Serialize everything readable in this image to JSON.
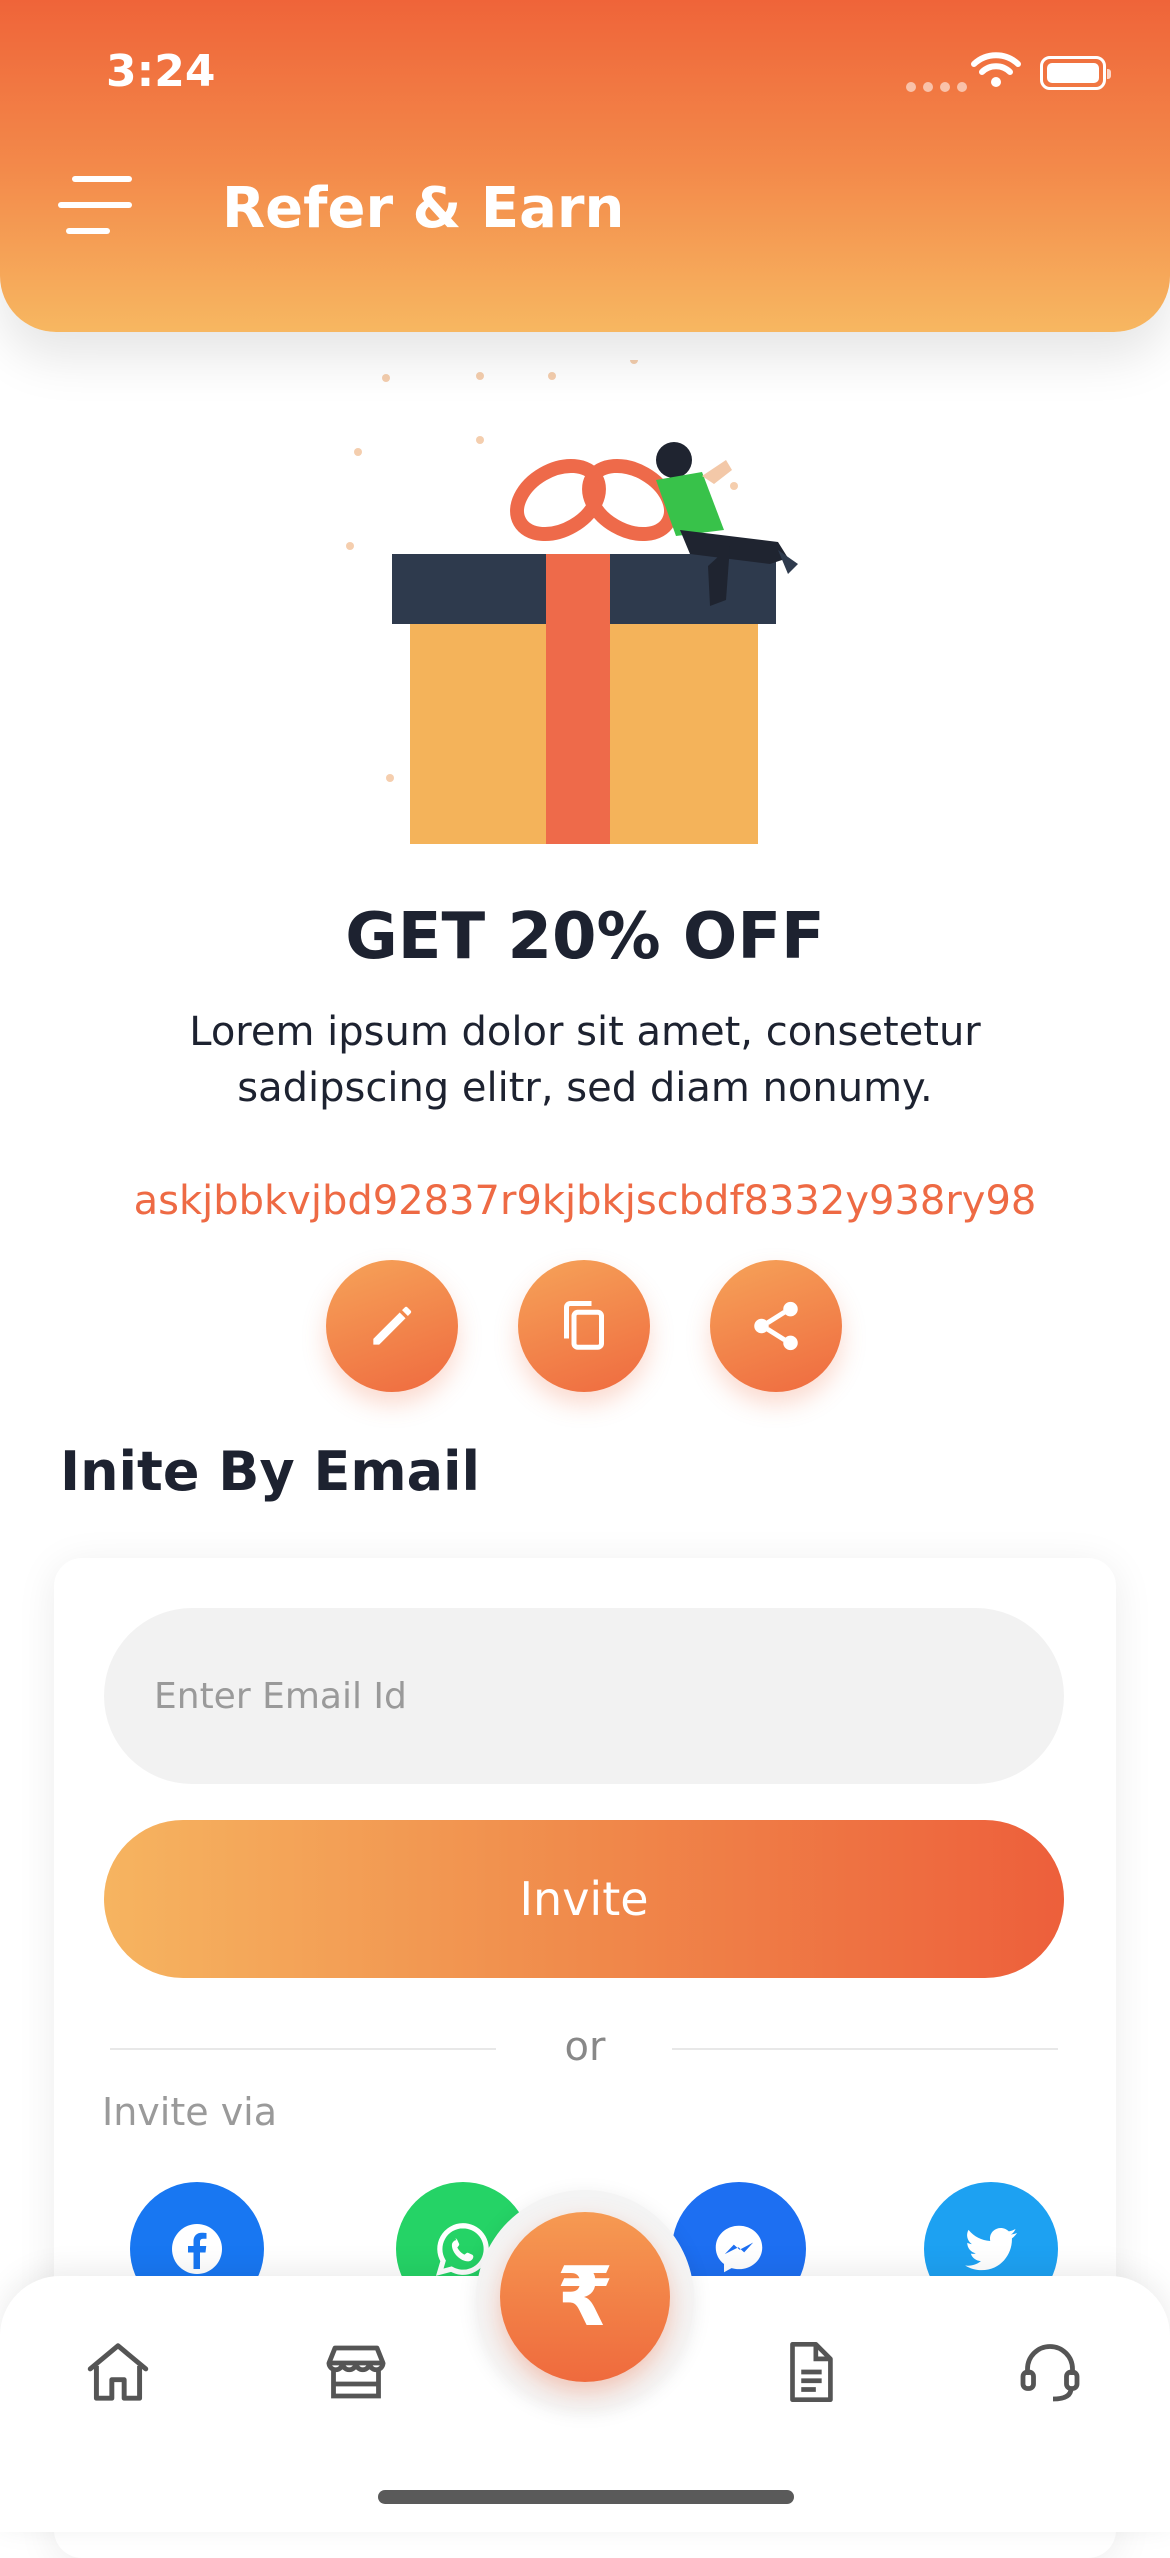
{
  "status_bar": {
    "time": "3:24"
  },
  "header": {
    "title": "Refer & Earn",
    "menu_icon": "hamburger-menu-icon"
  },
  "offer": {
    "title": "GET 20% OFF",
    "description": "Lorem ipsum dolor sit amet, consetetur sadipscing elitr, sed diam nonumy.",
    "referral_code": "askjbbkvjbd92837r9kjbkjscbdf8332y938ry98"
  },
  "actions": [
    {
      "icon": "edit-pencil-icon"
    },
    {
      "icon": "copy-icon"
    },
    {
      "icon": "share-icon"
    }
  ],
  "invite_email": {
    "section_title": "Inite By Email",
    "input_placeholder": "Enter Email Id",
    "input_value": "",
    "invite_label": "Invite",
    "or_label": "or",
    "invite_via_label": "Invite via"
  },
  "social": [
    {
      "name": "Facebook",
      "color": "#1877f2"
    },
    {
      "name": "WhatsApp",
      "color": "#25d366"
    },
    {
      "name": "Messenger",
      "color": "#1d6ff2"
    },
    {
      "name": "Twitter",
      "color": "#1da1f2"
    }
  ],
  "bottom_nav": {
    "items": [
      "home-icon",
      "store-icon",
      "document-icon",
      "support-headset-icon"
    ],
    "center_icon": "rupee-icon",
    "center_symbol": "₹"
  },
  "colors": {
    "accent": "#ef6a3f",
    "accent_light": "#f7b761",
    "text_dark": "#1d2230",
    "code_text": "#ee6a44"
  }
}
